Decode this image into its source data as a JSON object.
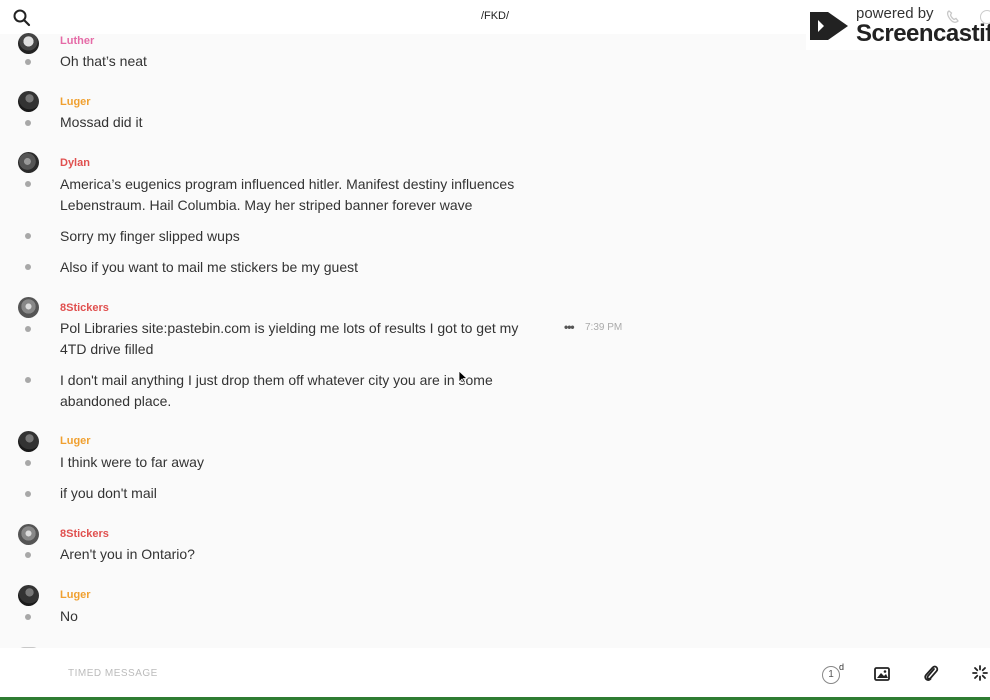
{
  "header": {
    "title": "/FKD/",
    "search_icon": "search-icon"
  },
  "watermark": {
    "top_text": "powered by",
    "brand": "Screencastify"
  },
  "messages": [
    {
      "author": "Luther",
      "lines": [
        "Oh that’s neat"
      ]
    },
    {
      "author": "Luger",
      "lines": [
        "Mossad did it"
      ]
    },
    {
      "author": "Dylan",
      "lines": [
        "America’s eugenics program influenced hitler. Manifest destiny influences Lebenstraum. Hail Columbia. May her striped banner forever wave",
        "Sorry my finger slipped wups",
        "Also if you want to mail me stickers be my guest"
      ]
    },
    {
      "author": "8Stickers",
      "lines": [
        "Pol Libraries site:pastebin.com is yielding me lots of results I got to get my 4TD drive filled",
        "I don't mail anything I just drop them off whatever city you are in some abandoned place."
      ],
      "time": "7:39 PM",
      "more": "•••"
    },
    {
      "author": "Luger",
      "lines": [
        "I think were to far away",
        "if you don't mail"
      ]
    },
    {
      "author": "8Stickers",
      "lines": [
        "Aren't you in Ontario?"
      ]
    },
    {
      "author": "Luger",
      "lines": [
        "No"
      ]
    }
  ],
  "composer": {
    "placeholder": "TIMED MESSAGE",
    "timer_value": "1",
    "timer_unit": "d"
  },
  "colors": {
    "luther": "#e56aa6",
    "luger": "#f0a030",
    "dylan": "#e0504f",
    "8stickers": "#e0504f",
    "composer_border": "#2e7d32"
  }
}
